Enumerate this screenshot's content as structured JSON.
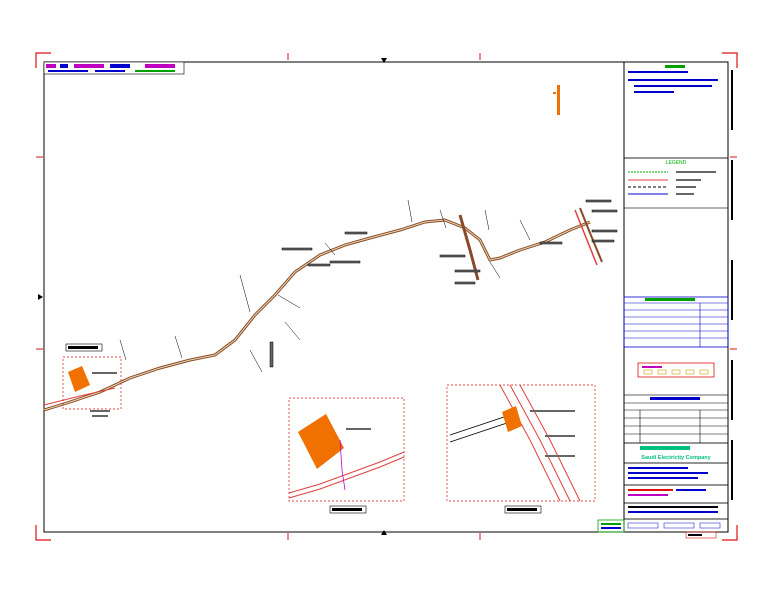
{
  "colors": {
    "frame": "#000000",
    "corner_marks": "#e01010",
    "title_bar_magenta": "#c000c0",
    "title_bar_green": "#00a000",
    "building_fill": "#f07000",
    "detail_border": "#e01010",
    "road": "#e04040",
    "route": "#8a4a2a",
    "legend_green": "#00b000",
    "panel_blue": "#0000cc",
    "company_name": "#00c080"
  },
  "panel": {
    "legend_title": "LEGEND",
    "company_name": "Saudi Electricity Company"
  }
}
